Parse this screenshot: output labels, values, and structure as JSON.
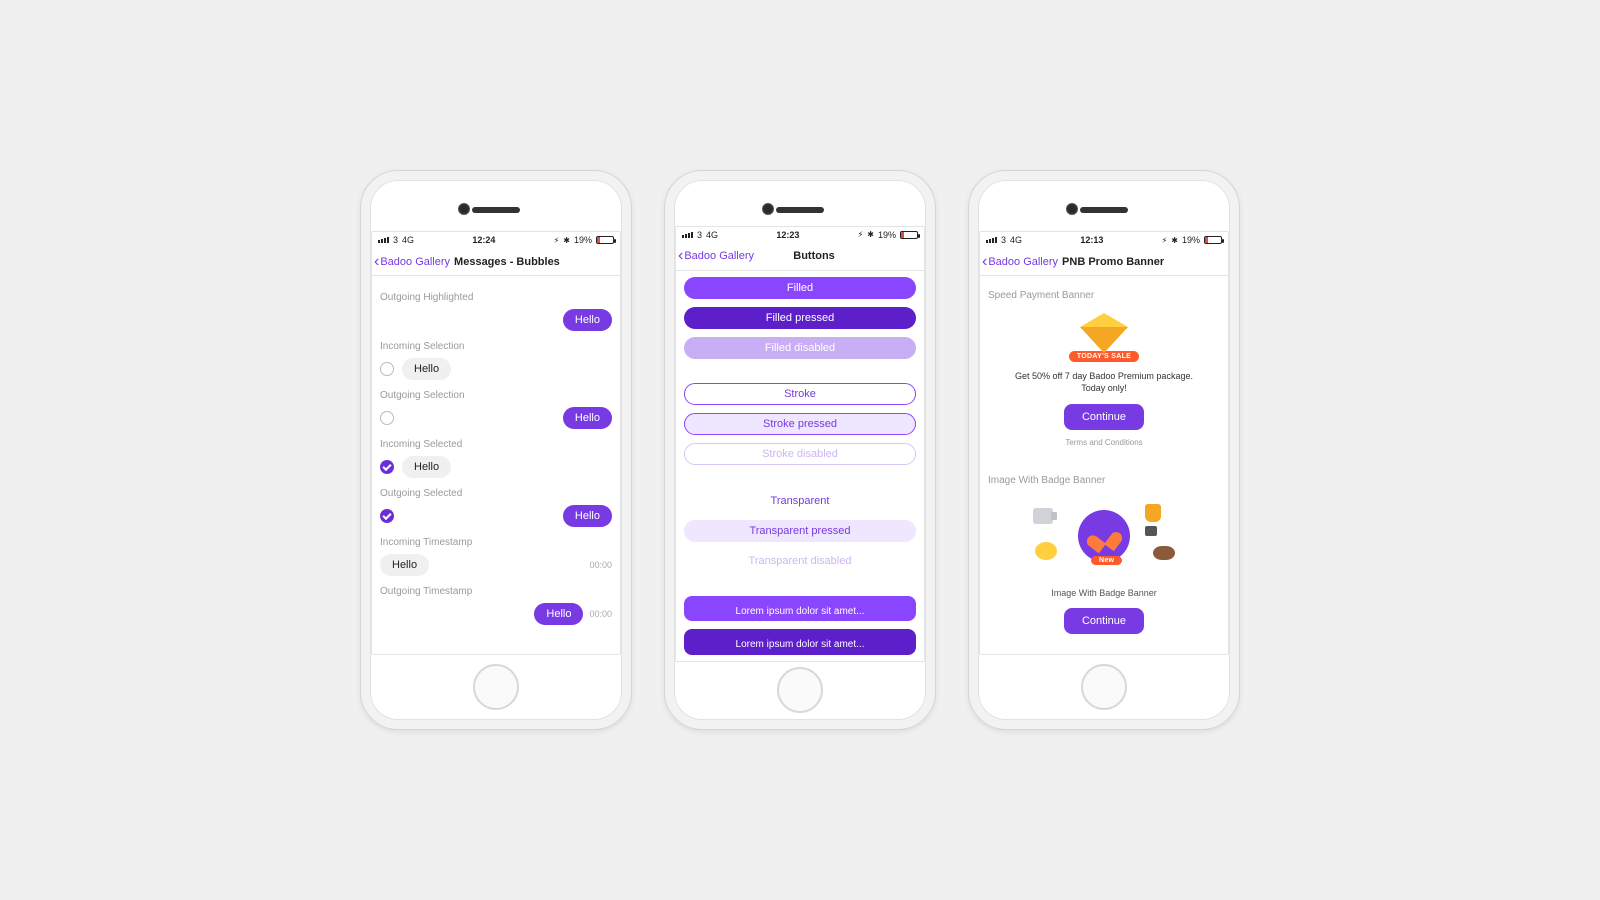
{
  "status": {
    "carrier": "3",
    "network": "4G",
    "bt_icon": "⚡",
    "bluetooth": "✻",
    "battery_pct": "19%"
  },
  "screens": {
    "messages": {
      "time": "12:24",
      "back": "Badoo Gallery",
      "title": "Messages - Bubbles",
      "sections": {
        "out_hl": "Outgoing Highlighted",
        "in_sel": "Incoming Selection",
        "out_sel": "Outgoing Selection",
        "in_selected": "Incoming Selected",
        "out_selected": "Outgoing Selected",
        "in_ts": "Incoming Timestamp",
        "out_ts": "Outgoing Timestamp"
      },
      "bubble_text": "Hello",
      "timestamp": "00:00"
    },
    "buttons": {
      "time": "12:23",
      "back": "Badoo Gallery",
      "title": "Buttons",
      "labels": {
        "filled": "Filled",
        "filled_pressed": "Filled pressed",
        "filled_disabled": "Filled disabled",
        "stroke": "Stroke",
        "stroke_pressed": "Stroke pressed",
        "stroke_disabled": "Stroke disabled",
        "transparent": "Transparent",
        "transparent_pressed": "Transparent pressed",
        "transparent_disabled": "Transparent disabled",
        "long1": "Lorem ipsum dolor sit amet...",
        "long2": "Lorem ipsum dolor sit amet..."
      }
    },
    "promo": {
      "time": "12:13",
      "back": "Badoo Gallery",
      "title": "PNB Promo Banner",
      "section1": "Speed Payment Banner",
      "chip1": "TODAY'S SALE",
      "desc1a": "Get 50% off 7 day Badoo Premium package.",
      "desc1b": "Today only!",
      "cta": "Continue",
      "tnc": "Terms and Conditions",
      "section2": "Image With Badge Banner",
      "chip2": "New",
      "caption2": "Image With Badge Banner"
    }
  }
}
